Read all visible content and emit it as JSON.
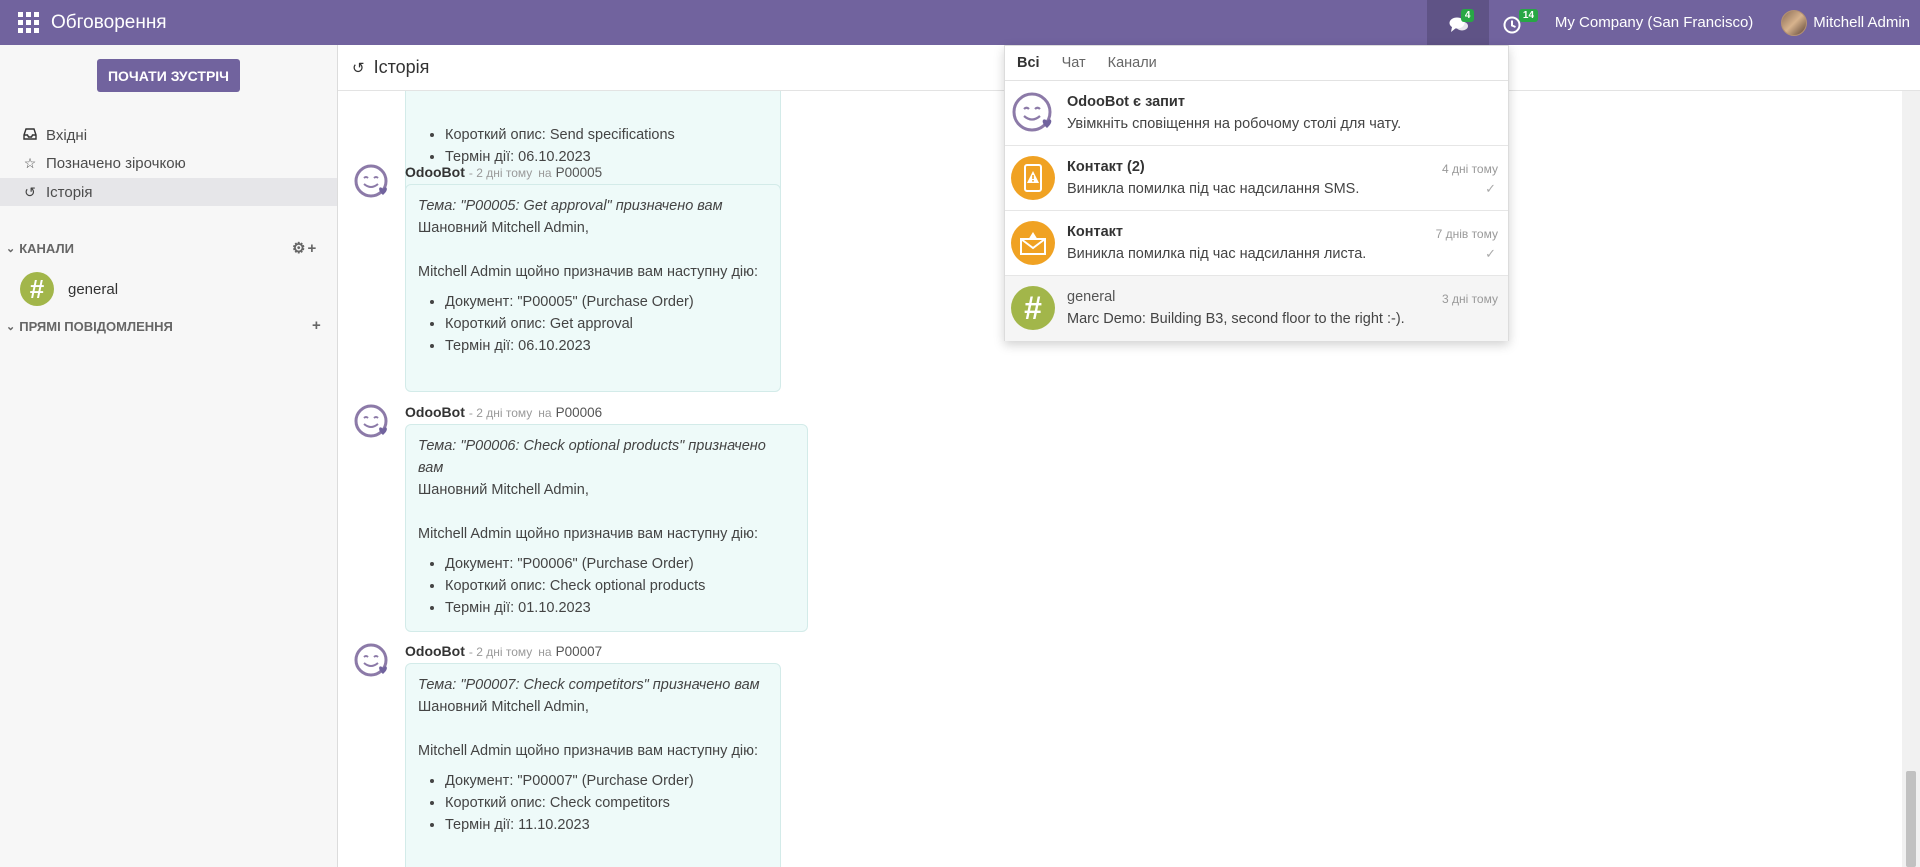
{
  "navbar": {
    "app_title": "Обговорення",
    "chat_badge": "4",
    "activity_badge": "14",
    "company": "My Company (San Francisco)",
    "user": "Mitchell Admin"
  },
  "sidebar": {
    "start_meeting": "ПОЧАТИ ЗУСТРІЧ",
    "items": [
      {
        "label": "Вхідні",
        "icon": "inbox-icon"
      },
      {
        "label": "Позначено зірочкою",
        "icon": "star-icon"
      },
      {
        "label": "Історія",
        "icon": "history-icon"
      }
    ],
    "channels_header": "КАНАЛИ",
    "channels": [
      {
        "name": "general",
        "avatar": "#"
      }
    ],
    "dm_header": "ПРЯМІ ПОВІДОМЛЕННЯ"
  },
  "main": {
    "title": "Історія",
    "partial": {
      "line1": "Короткий опис: Send specifications",
      "line2": "Термін дії: 06.10.2023"
    },
    "messages": [
      {
        "author": "OdooBot",
        "time": "- 2 дні тому",
        "on": "на",
        "record": "P00005",
        "subject": "Тема: \"P00005: Get approval\" призначено вам",
        "greeting": "Шановний Mitchell Admin,",
        "body": "Mitchell Admin щойно призначив вам наступну дію:",
        "items": [
          "Документ: \"P00005\" (Purchase Order)",
          "Короткий опис: Get approval",
          "Термін дії: 06.10.2023"
        ]
      },
      {
        "author": "OdooBot",
        "time": "- 2 дні тому",
        "on": "на",
        "record": "P00006",
        "subject": "Тема: \"P00006: Check optional products\" призначено вам",
        "greeting": "Шановний Mitchell Admin,",
        "body": "Mitchell Admin щойно призначив вам наступну дію:",
        "items": [
          "Документ: \"P00006\" (Purchase Order)",
          "Короткий опис: Check optional products",
          "Термін дії: 01.10.2023"
        ]
      },
      {
        "author": "OdooBot",
        "time": "- 2 дні тому",
        "on": "на",
        "record": "P00007",
        "subject": "Тема: \"P00007: Check competitors\" призначено вам",
        "greeting": "Шановний Mitchell Admin,",
        "body": "Mitchell Admin щойно призначив вам наступну дію:",
        "items": [
          "Документ: \"P00007\" (Purchase Order)",
          "Короткий опис: Check competitors",
          "Термін дії: 11.10.2023"
        ]
      }
    ]
  },
  "dropdown": {
    "tabs": [
      "Всі",
      "Чат",
      "Канали"
    ],
    "items": [
      {
        "title": "OdooBot є запит",
        "sub": "Увімкніть сповіщення на робочому столі для чату.",
        "date": "",
        "avatar": "odoobot-icon",
        "color": "#ffffff"
      },
      {
        "title": "Контакт (2)",
        "sub": "Виникла помилка під час надсилання SMS.",
        "date": "4 дні тому",
        "avatar": "sms-warning-icon",
        "color": "#f0a223"
      },
      {
        "title": "Контакт",
        "sub": "Виникла помилка під час надсилання листа.",
        "date": "7 днів тому",
        "avatar": "mail-warning-icon",
        "color": "#f0a223"
      },
      {
        "title": "general",
        "sub": "Marc Demo: Building B3, second floor to the right :-).",
        "date": "3 дні тому",
        "avatar": "channel-hash-icon",
        "color": "#a2b64a"
      }
    ]
  },
  "colors": {
    "brand": "#71639e",
    "bubble": "#eefaf9",
    "badge": "#28a745",
    "warning": "#f0a223",
    "channel": "#a2b64a"
  }
}
